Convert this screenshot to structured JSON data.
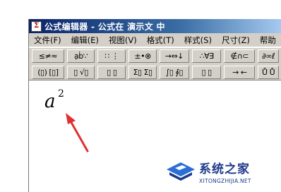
{
  "window": {
    "title": "公式编辑器 - 公式在 演示文 中",
    "app_icon_label": "Σ"
  },
  "menu": {
    "items": [
      {
        "label": "文件(F)"
      },
      {
        "label": "编辑(E)"
      },
      {
        "label": "视图(V)"
      },
      {
        "label": "格式(T)"
      },
      {
        "label": "样式(S)"
      },
      {
        "label": "尺寸(Z)"
      },
      {
        "label": "帮助"
      }
    ]
  },
  "toolbar": {
    "row1": [
      {
        "label": "≤≠≈",
        "width": 46
      },
      {
        "label": "ạḃ∵",
        "width": 40
      },
      {
        "label": "∷ ⋮",
        "width": 40
      },
      {
        "label": "±•⊗",
        "width": 40
      },
      {
        "label": "→⇔↓",
        "width": 42
      },
      {
        "label": "∴∀∃",
        "width": 42
      },
      {
        "label": "∉∩⊂",
        "width": 44
      },
      {
        "label": "∂∞ℓ",
        "width": 30
      }
    ],
    "row2": [
      {
        "label": "(▯) [▯]",
        "width": 46
      },
      {
        "label": "▯ √▯",
        "width": 40
      },
      {
        "label": "▯ ▯",
        "width": 40
      },
      {
        "label": "Σ▯ Σ▯",
        "width": 40
      },
      {
        "label": "∫▯ ∮▯",
        "width": 42
      },
      {
        "label": "▯ ▯",
        "width": 42
      },
      {
        "label": "→ ←",
        "width": 44
      },
      {
        "label": "Ů Ů",
        "width": 30
      }
    ]
  },
  "equation": {
    "base": "a",
    "superscript": "2"
  },
  "watermark": {
    "main_text": "系统之家",
    "sub_text": "XITONGZHIJIA.NET"
  },
  "colors": {
    "titlebar_start": "#0a246a",
    "titlebar_end": "#a6caf0",
    "toolbar_face": "#d4d0c8",
    "arrow": "#e03030",
    "watermark": "#1e3a8a"
  }
}
